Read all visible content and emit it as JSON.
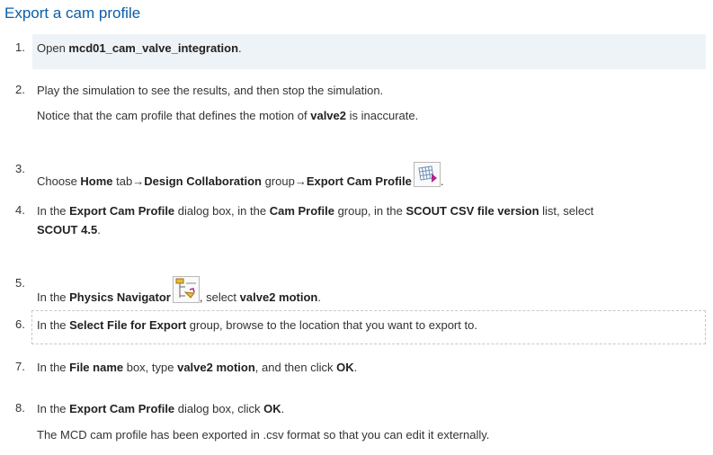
{
  "title": "Export a cam profile",
  "steps": [
    {
      "num": "1.",
      "pre": "Open ",
      "b1": "mcd01_cam_valve_integration",
      "post": "."
    },
    {
      "num": "2.",
      "line1": "Play the simulation to see the results, and then stop the simulation.",
      "note_pre": "Notice that the cam profile that defines the motion of ",
      "note_b": "valve2",
      "note_post": " is inaccurate."
    },
    {
      "num": "3.",
      "pre": "Choose ",
      "b1": "Home",
      "mid1": " tab→",
      "b2": "Design Collaboration",
      "mid2": " group→",
      "b3": "Export Cam Profile",
      "post": "."
    },
    {
      "num": "4.",
      "pre": "In the ",
      "b1": "Export Cam Profile",
      "mid1": " dialog box, in the ",
      "b2": "Cam Profile",
      "mid2": " group, in the ",
      "b3": "SCOUT CSV file version",
      "mid3": " list, select",
      "b4": "SCOUT 4.5",
      "post": "."
    },
    {
      "num": "5.",
      "pre": "In the ",
      "b1": "Physics Navigator",
      "mid1": ", select ",
      "b2": "valve2 motion",
      "post": "."
    },
    {
      "num": "6.",
      "pre": "In the ",
      "b1": "Select File for Export",
      "post": " group, browse to the location that you want to export to."
    },
    {
      "num": "7.",
      "pre": "In the ",
      "b1": "File name",
      "mid1": " box, type ",
      "b2": "valve2 motion",
      "mid2": ", and then click ",
      "b3": "OK",
      "post": "."
    },
    {
      "num": "8.",
      "pre": "In the ",
      "b1": "Export Cam Profile",
      "mid1": " dialog box, click ",
      "b2": "OK",
      "post": ".",
      "note": "The MCD cam profile has been exported in .csv format so that you can edit it externally."
    }
  ],
  "icons": {
    "export_cam_profile": "export-cam-profile-icon",
    "physics_navigator": "physics-navigator-icon"
  }
}
